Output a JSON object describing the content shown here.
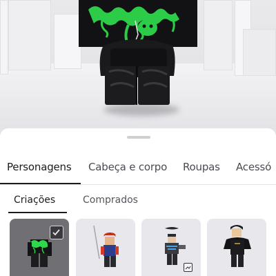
{
  "viewport": {
    "colors": {
      "background": "#e6e6ea",
      "outfit": "#161618",
      "glow": "#29d44a"
    }
  },
  "tabs": [
    {
      "label": "Personagens",
      "active": true
    },
    {
      "label": "Cabeça e corpo",
      "active": false
    },
    {
      "label": "Roupas",
      "active": false
    },
    {
      "label": "Acessó",
      "active": false
    }
  ],
  "subtabs": [
    {
      "label": "Criações",
      "active": true
    },
    {
      "label": "Comprados",
      "active": false
    }
  ],
  "characters": [
    {
      "icon": "green-glow-avatar-icon",
      "selected": true
    },
    {
      "icon": "sword-avatar-icon",
      "selected": false
    },
    {
      "icon": "jetpack-avatar-icon",
      "selected": false,
      "badge": "edit-badge-icon"
    },
    {
      "icon": "dark-coat-avatar-icon",
      "selected": false
    }
  ]
}
